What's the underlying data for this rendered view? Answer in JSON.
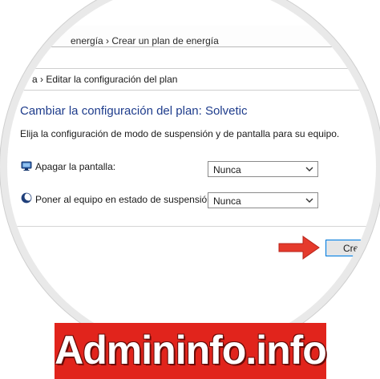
{
  "breadcrumb_top": {
    "text": "energía  ›  Crear un plan de energía"
  },
  "breadcrumb_main": {
    "text": "a  ›  Editar la configuración del plan"
  },
  "page": {
    "title": "Cambiar la configuración del plan: Solvetic",
    "subtitle": "Elija la configuración de modo de suspensión y de pantalla para su equipo."
  },
  "settings": [
    {
      "label": "Apagar la pantalla:",
      "value": "Nunca",
      "icon": "display-icon"
    },
    {
      "label": "Poner al equipo en estado de suspensión:",
      "value": "Nunca",
      "icon": "moon-icon"
    }
  ],
  "actions": {
    "create_label": "Crear"
  },
  "watermark": {
    "text": "Admininfo.info"
  },
  "colors": {
    "title_blue": "#1e3c8c",
    "accent_button_border": "#0078d7",
    "arrow_red": "#e53a2c",
    "banner_red": "#e1241c"
  }
}
